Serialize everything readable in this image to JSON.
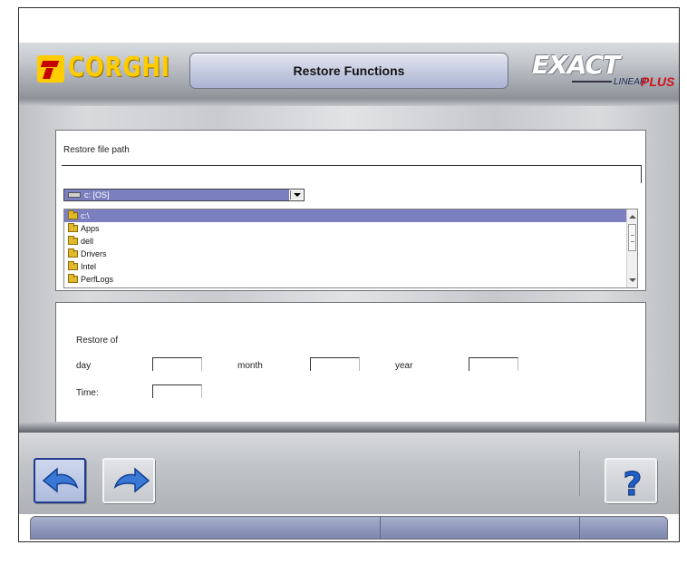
{
  "header": {
    "brand": "CORGHI",
    "title": "Restore Functions",
    "product_logo": {
      "word": "EXACT",
      "subword": "LINEAR",
      "suffix": "PLUS"
    }
  },
  "file_panel": {
    "path_label": "Restore file path",
    "path_value": "",
    "drive_selected": "c: [OS]",
    "directories": [
      "c:\\",
      "Apps",
      "dell",
      "Drivers",
      "Intel",
      "PerfLogs"
    ],
    "selected_directory_index": 0
  },
  "date_panel": {
    "restore_of_label": "Restore of",
    "day_label": "day",
    "month_label": "month",
    "year_label": "year",
    "time_label": "Time:",
    "day_value": "",
    "month_value": "",
    "year_value": "",
    "time_value": ""
  },
  "toolbar": {
    "back_icon": "back-arrow-icon",
    "forward_icon": "forward-arrow-icon",
    "help_icon": "question-mark-icon"
  },
  "colors": {
    "selection": "#7b7fbf",
    "brand_yellow": "#ffcc00",
    "brand_red": "#c40000",
    "plus_red": "#d0121a",
    "back_button_border": "#213b8e"
  }
}
